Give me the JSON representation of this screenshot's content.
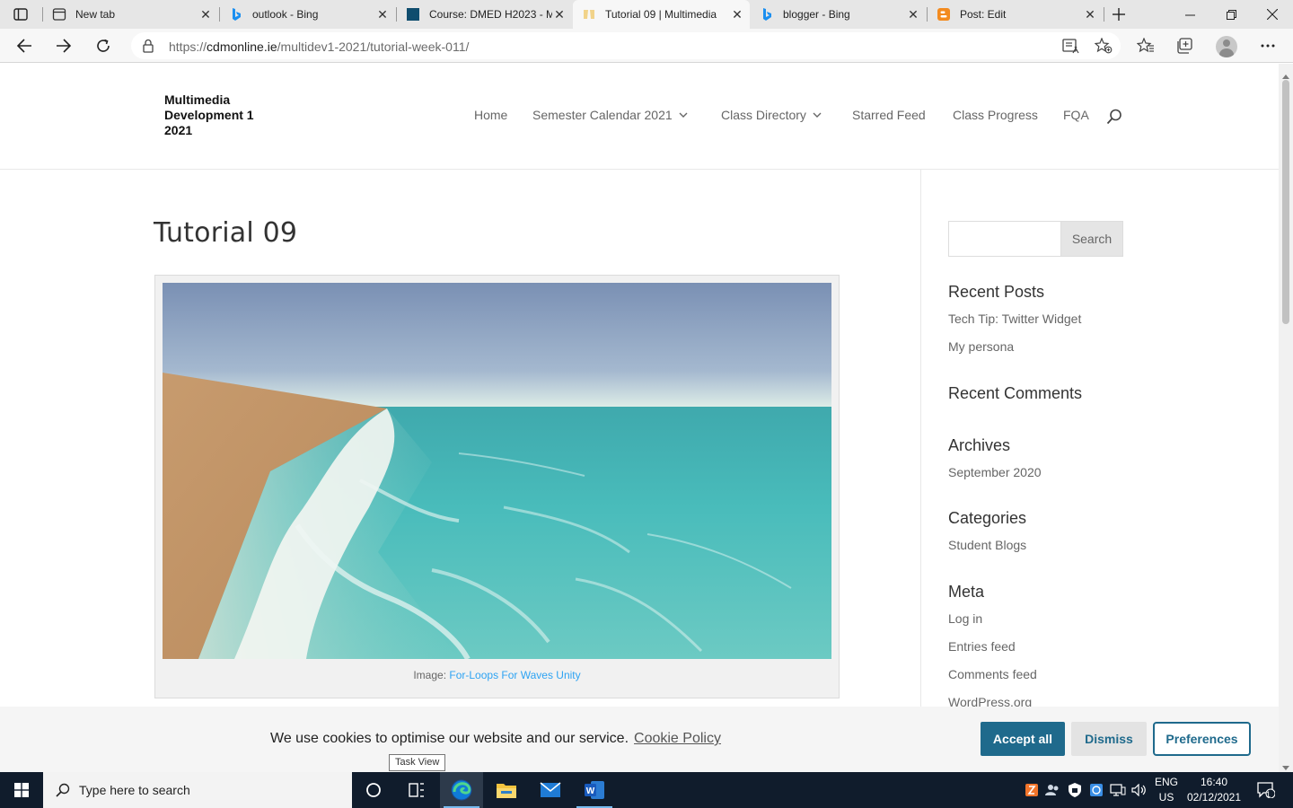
{
  "browser": {
    "tabs": [
      {
        "label": "New tab",
        "icon": "new-tab-icon"
      },
      {
        "label": "outlook - Bing",
        "icon": "bing-icon"
      },
      {
        "label": "Course: DMED H2023 - M",
        "icon": "moodle-icon"
      },
      {
        "label": "Tutorial 09 | Multimedia",
        "icon": "site-icon",
        "active": true
      },
      {
        "label": "blogger - Bing",
        "icon": "bing-icon"
      },
      {
        "label": "Post: Edit",
        "icon": "blogger-icon"
      }
    ],
    "url_prefix": "https://",
    "url_host": "cdmonline.ie",
    "url_path": "/multidev1-2021/tutorial-week-011/"
  },
  "site": {
    "logo": "Multimedia Development 1 2021",
    "nav": [
      "Home",
      "Semester Calendar 2021",
      "Class Directory",
      "Starred Feed",
      "Class Progress",
      "FQA"
    ]
  },
  "post": {
    "title": "Tutorial 09",
    "caption_prefix": "Image:",
    "caption_link": "For-Loops For Waves Unity"
  },
  "sidebar": {
    "search_button": "Search",
    "recent_posts_heading": "Recent Posts",
    "recent_posts": [
      "Tech Tip: Twitter Widget",
      "My persona"
    ],
    "recent_comments_heading": "Recent Comments",
    "archives_heading": "Archives",
    "archives": [
      "September 2020"
    ],
    "categories_heading": "Categories",
    "categories": [
      "Student Blogs"
    ],
    "meta_heading": "Meta",
    "meta": [
      "Log in",
      "Entries feed",
      "Comments feed",
      "WordPress.org"
    ]
  },
  "cookie": {
    "text": "We use cookies to optimise our website and our service.",
    "policy_link": "Cookie Policy",
    "accept": "Accept all",
    "dismiss": "Dismiss",
    "preferences": "Preferences"
  },
  "tooltip": "Task View",
  "taskbar": {
    "search_placeholder": "Type here to search",
    "lang_top": "ENG",
    "lang_bottom": "US",
    "time": "16:40",
    "date": "02/12/2021",
    "notification_count": "1"
  }
}
